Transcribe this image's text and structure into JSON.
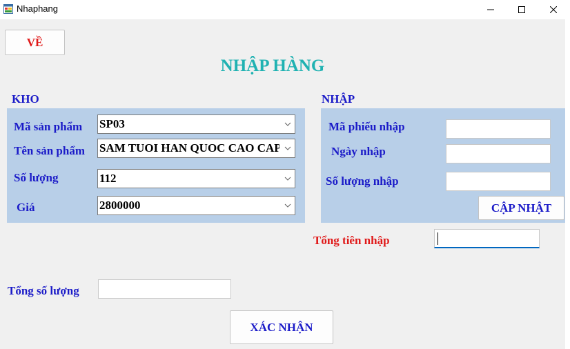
{
  "window": {
    "title": "Nhaphang",
    "app_icon": "form-app-icon"
  },
  "buttons": {
    "back": "VỀ",
    "update": "CẬP NHẬT",
    "confirm": "XÁC NHẬN"
  },
  "page_title": "NHẬP HÀNG",
  "kho": {
    "title": "KHO",
    "ma_san_pham": {
      "label": "Mã sản phẩm",
      "value": "SP03"
    },
    "ten_san_pham": {
      "label": "Tên sản phẩm",
      "value": "SAM TUOI HAN QUOC CAO CAP"
    },
    "so_luong": {
      "label": "Số lượng",
      "value": "112"
    },
    "gia": {
      "label": "Giá",
      "value": "2800000"
    }
  },
  "nhap": {
    "title": "NHẬP",
    "ma_phieu_nhap": {
      "label": "Mã phiếu nhập",
      "value": ""
    },
    "ngay_nhap": {
      "label": "Ngày nhập",
      "value": ""
    },
    "so_luong_nhap": {
      "label": "Số lượng nhập",
      "value": ""
    }
  },
  "tong_tien_nhap": {
    "label": "Tổng tiên nhập",
    "value": ""
  },
  "tong_so_luong": {
    "label": "Tổng số lượng",
    "value": ""
  },
  "colors": {
    "title_cyan": "#20b2b2",
    "label_blue": "#1b1bc8",
    "label_red": "#e01818",
    "panel_bg": "#b8cfe8",
    "window_bg": "#f0f0f0"
  }
}
